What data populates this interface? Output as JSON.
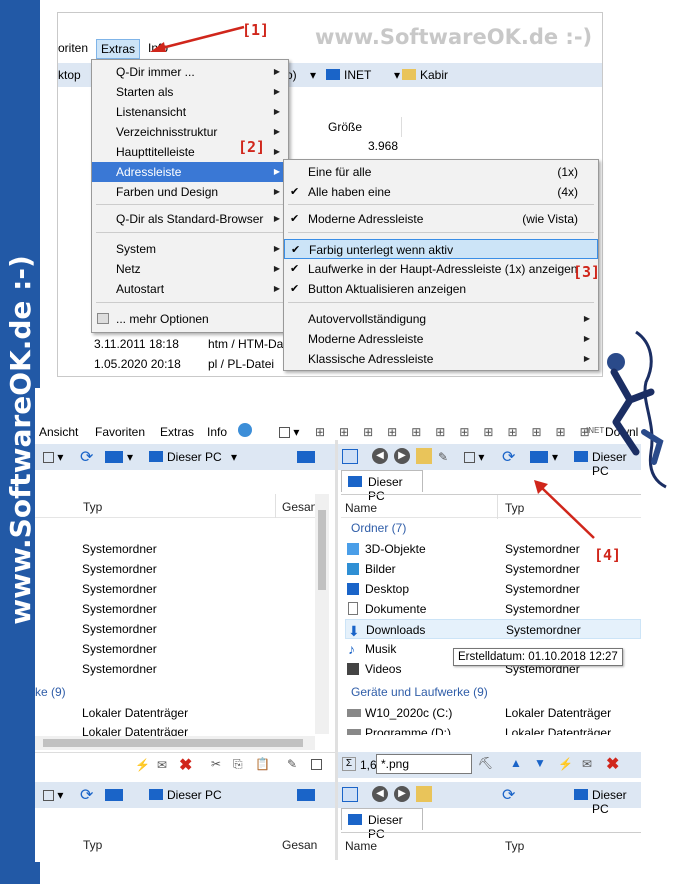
{
  "watermark_top": "www.SoftwareOK.de :-)",
  "watermark_side": "www.SoftwareOK.de :-)",
  "markers": {
    "m1": "[1]",
    "m2": "[2]",
    "m3": "[3]",
    "m4": "[4]"
  },
  "shot1": {
    "menubar": {
      "favoriten": "oriten",
      "extras": "Extras",
      "info": "Info"
    },
    "toolbar": {
      "desktop": "ktop",
      "inet": "INET",
      "kabir": "Kabir",
      "paren": "o)"
    },
    "column": "Größe",
    "size": "3.968",
    "rows": [
      {
        "date": "3.11.2011 18:18",
        "type": "htm / HTM-Da"
      },
      {
        "date": "1.05.2020 20:18",
        "type": "pl / PL-Datei"
      }
    ],
    "extras_menu": [
      "Q-Dir immer ...",
      "Starten als",
      "Listenansicht",
      "Verzeichnisstruktur",
      "Haupttitelleiste",
      "Adressleiste",
      "Farben und Design",
      "Q-Dir als Standard-Browser",
      "System",
      "Netz",
      "Autostart",
      "... mehr Optionen"
    ],
    "sub_menu": [
      {
        "label": "Eine für alle",
        "shortcut": "(1x)",
        "check": ""
      },
      {
        "label": "Alle haben eine",
        "shortcut": "(4x)",
        "check": "✔"
      },
      {
        "label": "Moderne Adressleiste",
        "shortcut": "(wie Vista)",
        "check": "✔"
      },
      {
        "label": "Farbig unterlegt wenn aktiv",
        "shortcut": "",
        "check": "✔"
      },
      {
        "label": "Laufwerke in der Haupt-Adressleiste (1x) anzeigen",
        "shortcut": "",
        "check": "✔"
      },
      {
        "label": "Button Aktualisieren anzeigen",
        "shortcut": "",
        "check": "✔"
      },
      {
        "label": "Autovervollständigung",
        "shortcut": "",
        "check": ""
      },
      {
        "label": "Moderne Adressleiste",
        "shortcut": "",
        "check": ""
      },
      {
        "label": "Klassische Adressleiste",
        "shortcut": "",
        "check": ""
      }
    ]
  },
  "shot2": {
    "menubar": [
      "Ansicht",
      "Favoriten",
      "Extras",
      "Info"
    ],
    "down": "Downl",
    "inet": "INET",
    "location": "Dieser PC",
    "tab": "Dieser PC",
    "left_cols": {
      "typ": "Typ",
      "gesamt": "Gesan"
    },
    "right_cols": {
      "name": "Name",
      "typ": "Typ"
    },
    "left_rows": [
      "Systemordner",
      "Systemordner",
      "Systemordner",
      "Systemordner",
      "Systemordner",
      "Systemordner",
      "Systemordner"
    ],
    "left_group": "ke (9)",
    "left_drives": [
      "Lokaler Datenträger",
      "Lokaler Datenträger"
    ],
    "group_ordner": "Ordner (7)",
    "folders": [
      {
        "name": "3D-Objekte",
        "type": "Systemordner"
      },
      {
        "name": "Bilder",
        "type": "Systemordner"
      },
      {
        "name": "Desktop",
        "type": "Systemordner"
      },
      {
        "name": "Dokumente",
        "type": "Systemordner"
      },
      {
        "name": "Downloads",
        "type": "Systemordner"
      },
      {
        "name": "Musik",
        "type": ""
      },
      {
        "name": "Videos",
        "type": "Systemordner"
      }
    ],
    "tooltip": "Erstelldatum: 01.10.2018 12:27",
    "group_drives": "Geräte und Laufwerke (9)",
    "drives": [
      {
        "name": "W10_2020c (C:)",
        "type": "Lokaler Datenträger"
      },
      {
        "name": "Programme (D:)",
        "type": "Lokaler Datenträger"
      }
    ],
    "filter_value": "*.png",
    "filter_prefix": "1,6",
    "bottom_location": "Dieser PC",
    "bottom_tab": "Dieser PC",
    "bottom_cols": {
      "typ": "Typ",
      "gesamt": "Gesan",
      "name": "Name",
      "typ2": "Typ"
    }
  }
}
